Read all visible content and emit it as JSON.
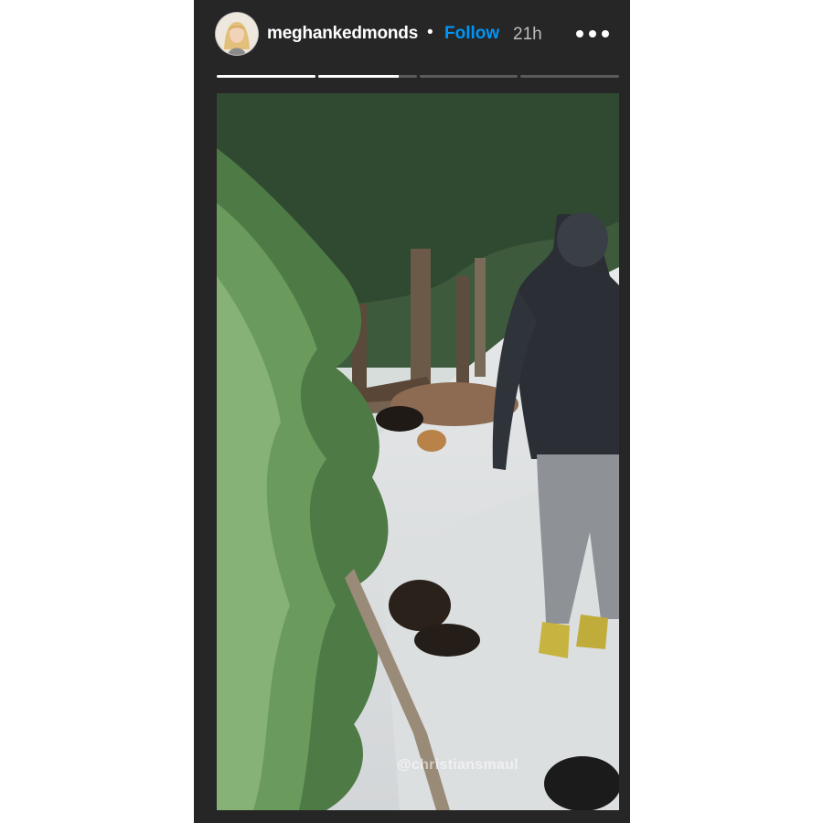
{
  "story": {
    "username": "meghankedmonds",
    "separator": "•",
    "follow_label": "Follow",
    "time_ago": "21h",
    "more_icon": "more-horizontal-icon",
    "progress_segments": [
      1,
      0.82,
      0,
      0
    ],
    "media": {
      "watermark": "@christiansmaul"
    }
  },
  "colors": {
    "background": "#262626",
    "follow": "#0095f6",
    "text": "#ffffff"
  }
}
